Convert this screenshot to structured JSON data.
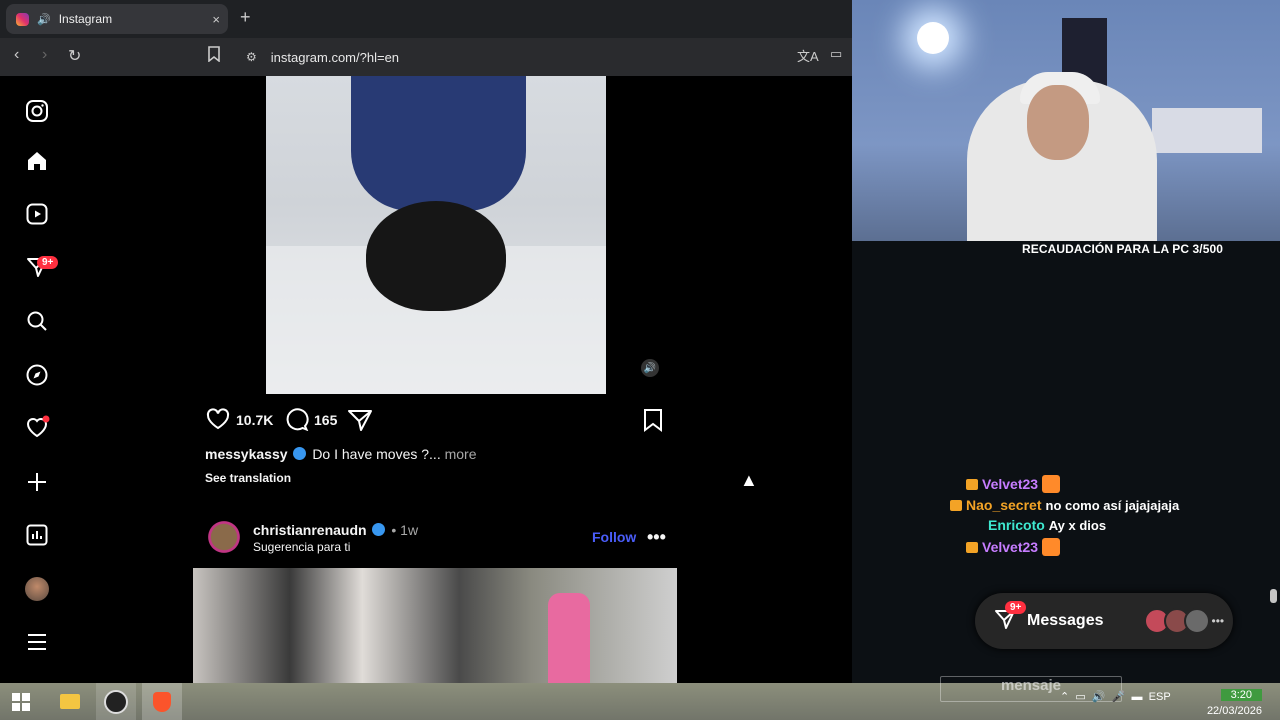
{
  "browser": {
    "tab_title": "Instagram",
    "new_tab": "+",
    "close": "×",
    "url": "instagram.com/?hl=en"
  },
  "sidebar": {
    "notifications_badge": "9+"
  },
  "post1": {
    "likes": "10.7K",
    "comments": "165",
    "username": "messykassy",
    "caption": "Do I have moves ?...",
    "more": "more",
    "see_translation": "See translation"
  },
  "post2": {
    "username": "christianrenaudn",
    "time": "• 1w",
    "subtitle": "Sugerencia para ti",
    "follow": "Follow"
  },
  "stream": {
    "goal_text": "RECAUDACIÓN PARA LA PC 3/500",
    "chat": [
      {
        "user": "Velvet23",
        "color": "#c77dff",
        "message": ""
      },
      {
        "user": "Nao_secret",
        "color": "#f3a326",
        "message": "no como así jajajajaja"
      },
      {
        "user": "Enricoto",
        "color": "#3ee8d0",
        "message": "Ay x dios"
      },
      {
        "user": "Velvet23",
        "color": "#c77dff",
        "message": ""
      }
    ]
  },
  "messages": {
    "label": "Messages",
    "badge": "9+"
  },
  "taskbar": {
    "input_overlay": "mensaje",
    "lang": "ESP",
    "time": "3:20",
    "date": "22/03/2026"
  }
}
